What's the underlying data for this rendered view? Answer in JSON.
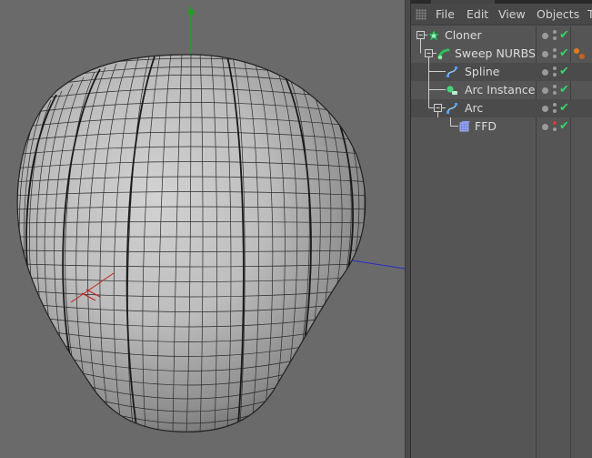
{
  "menu": {
    "file": "File",
    "edit": "Edit",
    "view": "View",
    "objects": "Objects",
    "overflow": "T"
  },
  "objects": [
    {
      "name": "Cloner",
      "icon": "cloner-icon",
      "level": 0,
      "visible": true,
      "tags": []
    },
    {
      "name": "Sweep NURBS",
      "icon": "sweep-nurbs-icon",
      "level": 1,
      "visible": true,
      "tags": [
        "phong-tag-icon"
      ]
    },
    {
      "name": "Spline",
      "icon": "spline-icon",
      "level": 2,
      "visible": true,
      "tags": []
    },
    {
      "name": "Arc Instance",
      "icon": "instance-icon",
      "level": 2,
      "visible": true,
      "tags": []
    },
    {
      "name": "Arc",
      "icon": "arc-spline-icon",
      "level": 2,
      "visible": true,
      "tags": []
    },
    {
      "name": "FFD",
      "icon": "ffd-deformer-icon",
      "level": 3,
      "visible": true,
      "tags": []
    }
  ],
  "colors": {
    "viewport_bg": "#6a6a6a",
    "check_green": "#39d26b",
    "axis_y": "#1ca31c",
    "axis_x": "#c02020",
    "axis_z": "#2a2ad0"
  }
}
